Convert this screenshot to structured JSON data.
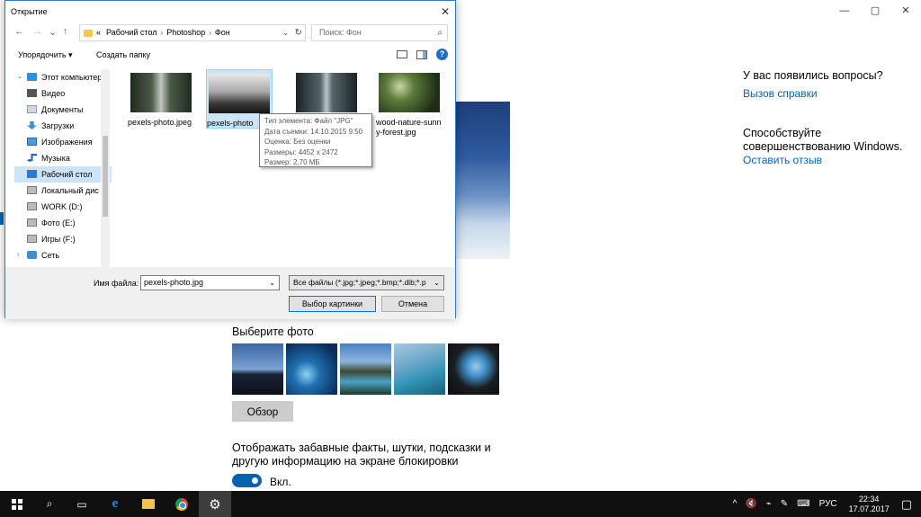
{
  "settings": {
    "window_controls": [
      "—",
      "▢",
      "✕"
    ],
    "help": {
      "question": "У вас появились вопросы?",
      "help_link": "Вызов справки",
      "contribute": "Способствуйте совершенствованию Windows.",
      "feedback_link": "Оставить отзыв"
    },
    "choose_photo_label": "Выберите фото",
    "browse_button": "Обзор",
    "fun_facts_text": "Отображать забавные факты, шутки, подсказки и другую информацию на экране блокировки",
    "toggle_label": "Вкл.",
    "toggle_on": true
  },
  "dialog": {
    "title": "Открытие",
    "close": "✕",
    "nav": {
      "back": "←",
      "forward": "→",
      "recent": "⌄",
      "up": "↑"
    },
    "address": {
      "prefix": "«",
      "parts": [
        "Рабочий стол",
        "Photoshop",
        "Фон"
      ],
      "separator": "›"
    },
    "search_placeholder": "Поиск: Фон",
    "toolbar": {
      "organize": "Упорядочить ▾",
      "new_folder": "Создать папку",
      "help": "?"
    },
    "tree": [
      {
        "label": "Этот компьютер",
        "icon": "pc-icon"
      },
      {
        "label": "Видео",
        "icon": "video-icon"
      },
      {
        "label": "Документы",
        "icon": "documents-icon"
      },
      {
        "label": "Загрузки",
        "icon": "downloads-icon"
      },
      {
        "label": "Изображения",
        "icon": "pictures-icon"
      },
      {
        "label": "Музыка",
        "icon": "music-icon"
      },
      {
        "label": "Рабочий стол",
        "icon": "desktop-icon",
        "selected": true
      },
      {
        "label": "Локальный дис",
        "icon": "drive-icon"
      },
      {
        "label": "WORK (D:)",
        "icon": "drive-icon"
      },
      {
        "label": "Фото (E:)",
        "icon": "drive-icon"
      },
      {
        "label": "Игры (F:)",
        "icon": "drive-icon"
      },
      {
        "label": "Сеть",
        "icon": "network-icon"
      }
    ],
    "files": [
      {
        "name": "pexels-photo.jpeg"
      },
      {
        "name": "pexels-photo",
        "selected": true
      },
      {
        "name": ""
      },
      {
        "name": "wood-nature-sunny-forest.jpg"
      }
    ],
    "tooltip": [
      "Тип элемента: Файл \"JPG\"",
      "Дата съемки: 14.10.2015 9:50",
      "Оценка: Без оценки",
      "Размеры: 4452 x 2472",
      "Размер: 2,70 МБ"
    ],
    "filename_label": "Имя файла:",
    "filename_value": "pexels-photo.jpg",
    "filetype_value": "Все файлы (*.jpg;*.jpeg;*.bmp;*.dib;*.p",
    "open_button": "Выбор картинки",
    "cancel_button": "Отмена"
  },
  "taskbar": {
    "language": "РУС",
    "time": "22:34",
    "date": "17.07.2017",
    "tray_glyphs": [
      "^",
      "🔇",
      "⌁",
      "✎"
    ]
  },
  "colors": {
    "accent": "#0063b1",
    "selection": "#cce4f7",
    "taskbar": "#101010"
  }
}
